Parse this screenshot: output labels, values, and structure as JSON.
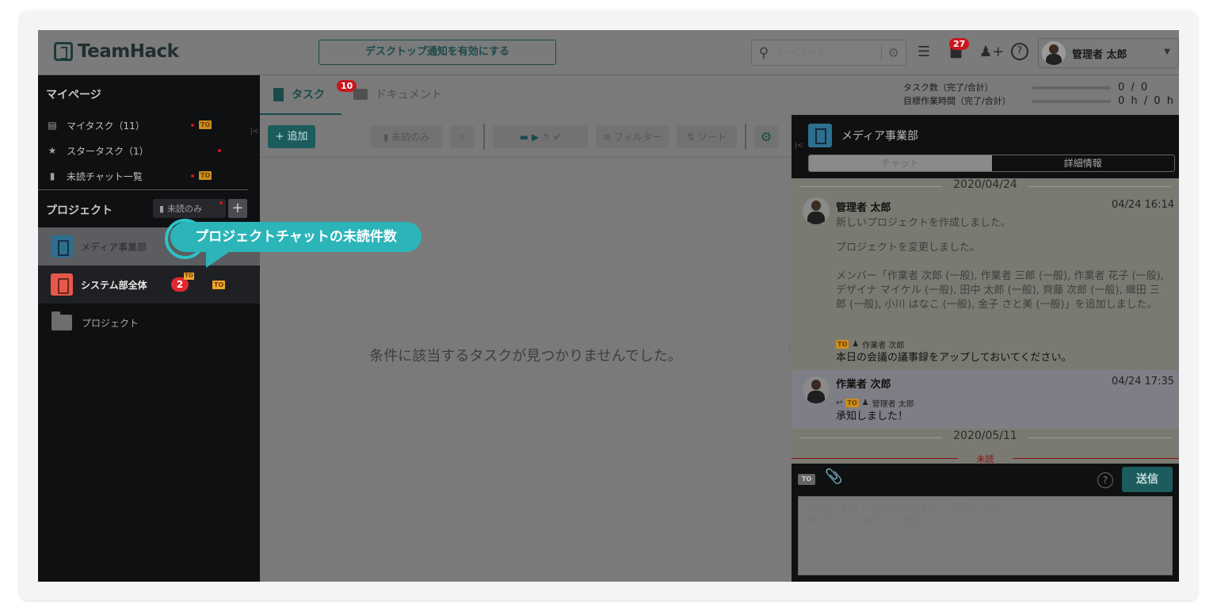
{
  "header": {
    "logo": "TeamHack",
    "notify_button": "デスクトップ通知を有効にする",
    "search_placeholder": "キーワード",
    "notification_count": "27",
    "user_name": "管理者 太郎"
  },
  "sidebar": {
    "mypage_title": "マイページ",
    "mypage_items": [
      {
        "label": "マイタスク（11）",
        "icon": "document-user-icon",
        "to": "TO"
      },
      {
        "label": "スタータスク（1）",
        "icon": "star-icon",
        "to": ""
      },
      {
        "label": "未読チャット一覧",
        "icon": "chat-bubble-icon",
        "to": "TO"
      }
    ],
    "projects_title": "プロジェクト",
    "unread_only_label": "未読のみ",
    "projects": [
      {
        "name": "メディア事業部",
        "color": "#2e6e8e",
        "state": "active"
      },
      {
        "name": "システム部全体",
        "color": "#e8584a",
        "unread": "2",
        "to": "TO"
      }
    ],
    "folder_label": "プロジェクト"
  },
  "callout": {
    "text": "プロジェクトチャットの未読件数"
  },
  "main": {
    "tabs": [
      {
        "label": "タスク",
        "badge": "10"
      },
      {
        "label": "ドキュメント"
      }
    ],
    "toolbar": {
      "add_label": "+ 追加",
      "unread_only_label": "未読のみ",
      "filter_label": "フィルター",
      "sort_label": "ソート"
    },
    "empty_message": "条件に該当するタスクが見つかりませんでした。"
  },
  "stats": {
    "task_count_label": "タスク数（完了/合計）",
    "task_count_value": "0 / 0",
    "work_hours_label": "目標作業時間（完了/合計）",
    "work_hours_value": "0 h / 0 h"
  },
  "chat": {
    "project_name": "メディア事業部",
    "tabs": [
      "チャット",
      "詳細情報"
    ],
    "date1": "2020/04/24",
    "messages": [
      {
        "author": "管理者 太郎",
        "time": "04/24 16:14",
        "text1": "新しいプロジェクトを作成しました。",
        "text2": "プロジェクトを変更しました。",
        "text3": "メンバー「作業者 次郎 (一般), 作業者 三郎 (一般), 作業者 花子 (一般), デザイナ マイケル (一般), 田中 太郎 (一般), 齊藤 次郎 (一般), 織田 三郎 (一般), 小川 はなこ (一般), 金子 さと美 (一般)」を追加しました。",
        "to_target": "作業者 次郎",
        "text4": "本日の会議の議事録をアップしておいてください。"
      },
      {
        "author": "作業者 次郎",
        "time": "04/24 17:35",
        "to_target": "管理者 太郎",
        "text": "承知しました！"
      }
    ],
    "date2": "2020/05/11",
    "unread_label": "未読",
    "input_placeholder": "プロジェクト全体での共有にご利用ください。\nShift + Enterキーで送信",
    "send_label": "送信",
    "to_label": "TO"
  }
}
